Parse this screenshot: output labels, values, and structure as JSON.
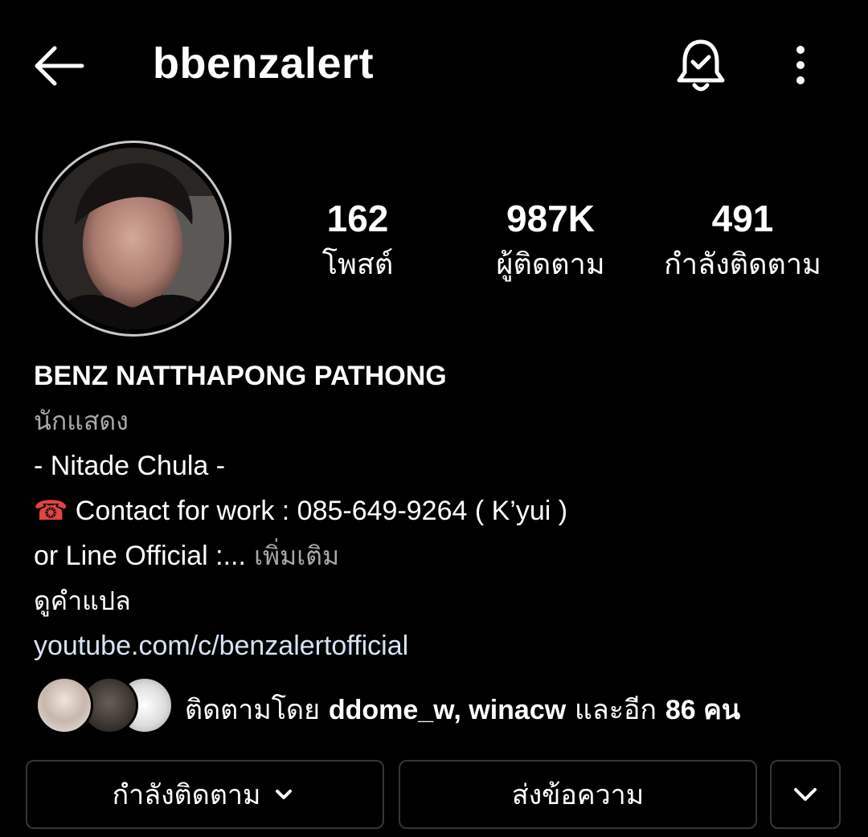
{
  "header": {
    "username": "bbenzalert",
    "icons": {
      "back": "arrow-left-icon",
      "notify": "bell-check-icon",
      "more": "more-vertical-icon"
    }
  },
  "stats": [
    {
      "value": "162",
      "label": "โพสต์"
    },
    {
      "value": "987K",
      "label": "ผู้ติดตาม"
    },
    {
      "value": "491",
      "label": "กำลังติดตาม"
    }
  ],
  "bio": {
    "name": "BENZ NATTHAPONG PATHONG",
    "category": "นักแสดง",
    "line1": "- Nitade Chula -",
    "phone_icon": "☎",
    "contact": " Contact for work : 085-649-9264 ( K’yui )",
    "line3": "or Line Official :...",
    "more": " เพิ่มเติม",
    "translate": "ดูคำแปล",
    "link": "youtube.com/c/benzalertofficial"
  },
  "followed_by": {
    "prefix": "ติดตามโดย ",
    "names": "ddome_w, winacw",
    "suffix": " และอีก ",
    "count": "86 คน"
  },
  "actions": {
    "following": "กำลังติดตาม",
    "message": "ส่งข้อความ"
  },
  "colors": {
    "background": "#000000",
    "text": "#ffffff",
    "secondary": "#a8a8a8",
    "link": "#d7e3f5",
    "border": "#363636"
  }
}
